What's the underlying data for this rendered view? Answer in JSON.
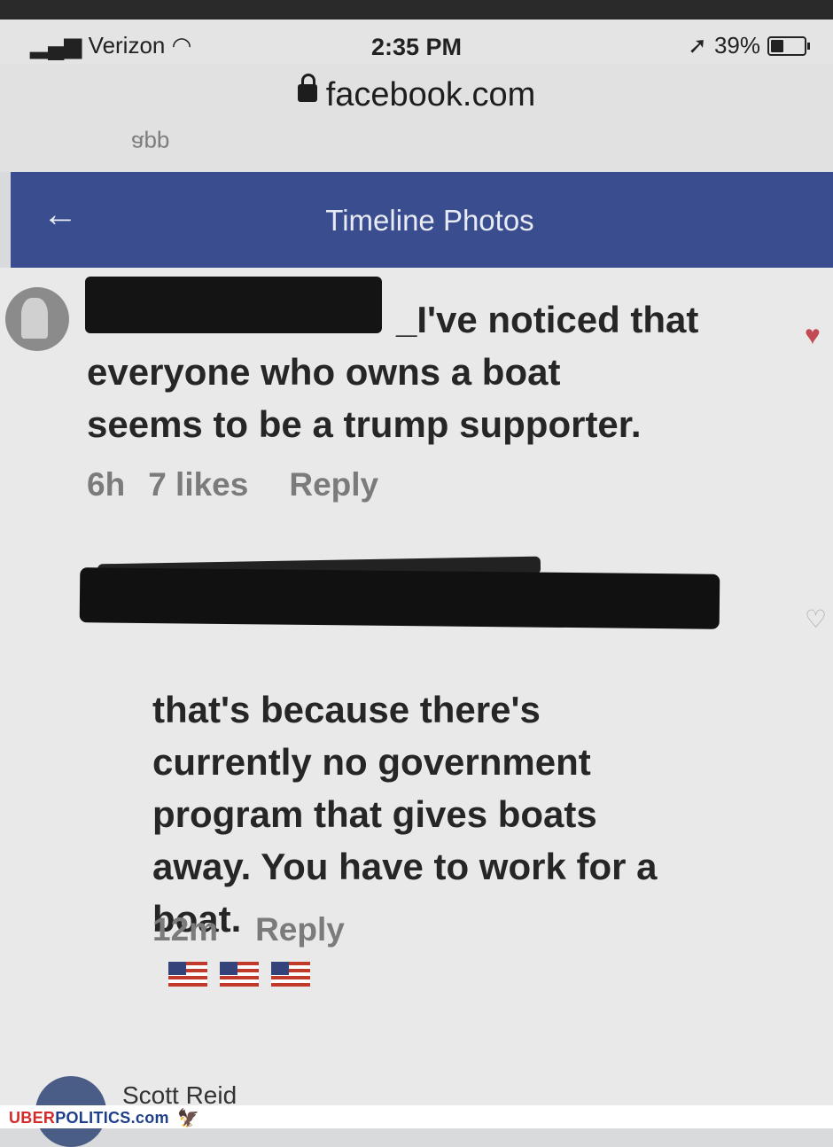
{
  "status_bar": {
    "carrier": "Verizon",
    "time": "2:35 PM",
    "battery": "39%",
    "battery_level": 0.39
  },
  "browser": {
    "url": "facebook.com",
    "prev_text": "app"
  },
  "nav": {
    "title": "Timeline Photos",
    "back_icon": "arrow-left-icon"
  },
  "comments": [
    {
      "text_first_line": "_I've noticed that",
      "text_rest": "everyone who owns a boat\nseems to be a trump supporter.",
      "time": "6h",
      "likes": "7 likes",
      "reply": "Reply",
      "liked": true
    },
    {
      "text": "that's because there's\ncurrently no government\nprogram that gives boats\naway. You have to work for a\nboat.",
      "time": "12m",
      "reply": "Reply",
      "emoji_count": 3
    }
  ],
  "next_comment": {
    "author": "Scott Reid"
  },
  "watermark": {
    "brand_part1": "UBER",
    "brand_part2": "POLITICS.com"
  },
  "colors": {
    "nav_bg": "#3a4d8f",
    "like_heart": "#c34a55"
  }
}
